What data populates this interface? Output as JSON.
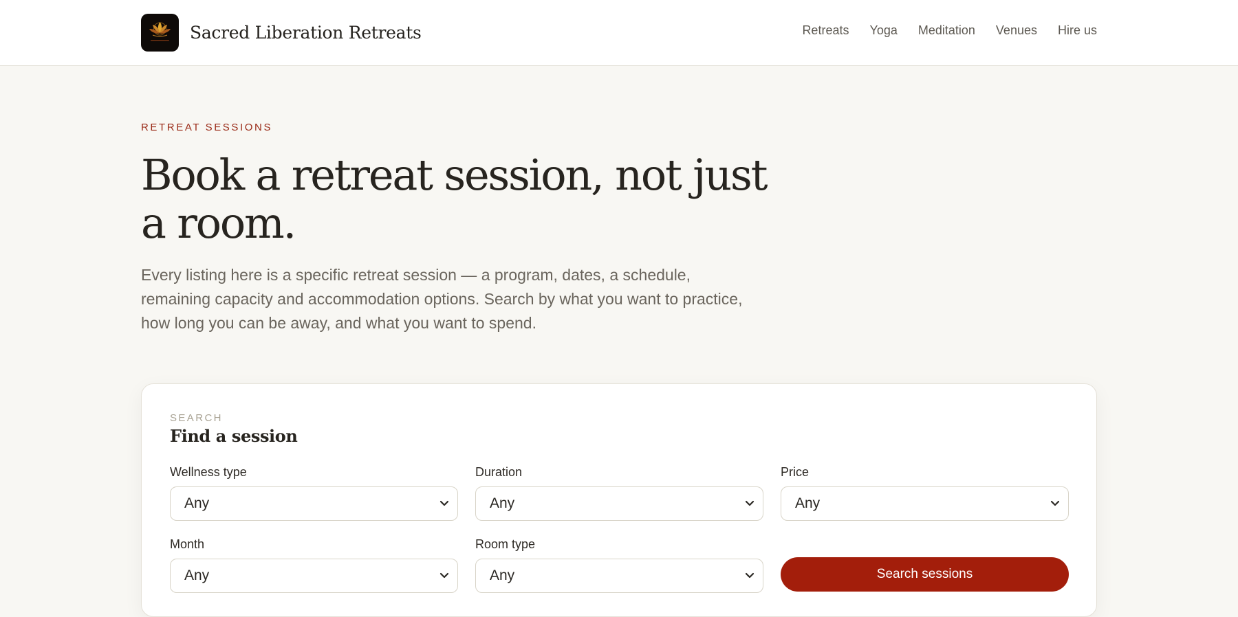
{
  "brand": {
    "name": "Sacred Liberation Retreats",
    "logo_icon": "lotus-icon",
    "colors": {
      "logo_bg": "#0e0a08",
      "lotus": "#d9a531"
    }
  },
  "nav": {
    "items": [
      {
        "label": "Retreats"
      },
      {
        "label": "Yoga"
      },
      {
        "label": "Meditation"
      },
      {
        "label": "Venues"
      },
      {
        "label": "Hire us"
      }
    ]
  },
  "hero": {
    "eyebrow": "RETREAT SESSIONS",
    "title": "Book a retreat session, not just a room.",
    "description": "Every listing here is a specific retreat session — a program, dates, a schedule, remaining capacity and accommodation options. Search by what you want to practice, how long you can be away, and what you want to spend."
  },
  "search": {
    "eyebrow": "SEARCH",
    "title": "Find a session",
    "fields": {
      "wellness_type": {
        "label": "Wellness type",
        "value": "Any"
      },
      "duration": {
        "label": "Duration",
        "value": "Any"
      },
      "price": {
        "label": "Price",
        "value": "Any"
      },
      "month": {
        "label": "Month",
        "value": "Any"
      },
      "room_type": {
        "label": "Room type",
        "value": "Any"
      }
    },
    "submit_label": "Search sessions",
    "chevron_icon": "chevron-down-icon"
  },
  "colors": {
    "accent": "#a31e0b",
    "eyebrow": "#9a2a17",
    "page_bg": "#f8f7f3"
  }
}
